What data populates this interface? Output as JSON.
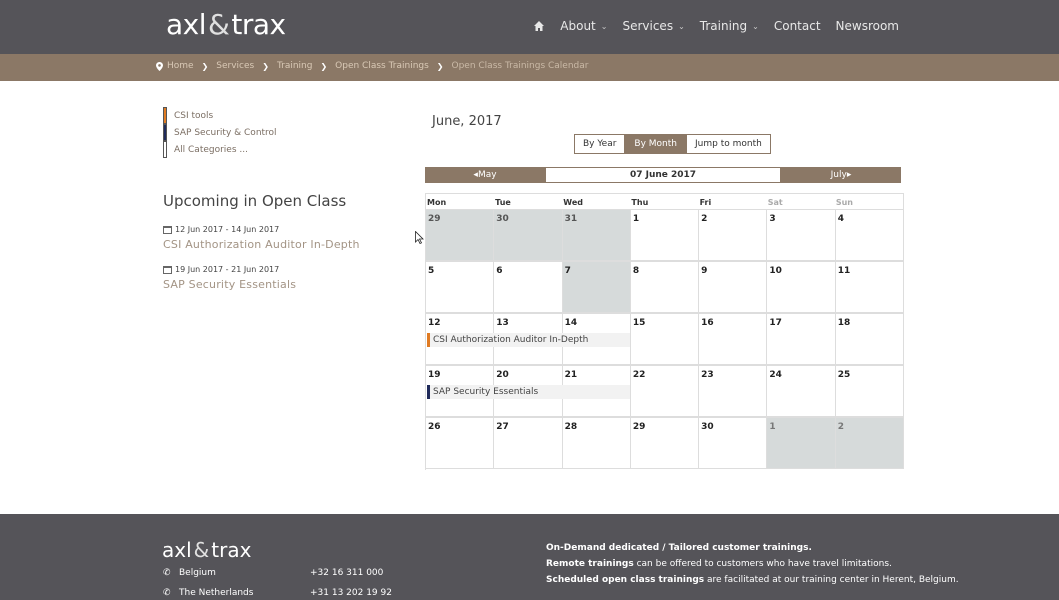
{
  "header": {
    "logo": {
      "part1": "axl",
      "amp": "&",
      "part2": "trax"
    },
    "nav": [
      {
        "label": "About",
        "caret": true
      },
      {
        "label": "Services",
        "caret": true
      },
      {
        "label": "Training",
        "caret": true
      },
      {
        "label": "Contact",
        "caret": false
      },
      {
        "label": "Newsroom",
        "caret": false
      }
    ]
  },
  "breadcrumb": [
    "Home",
    "Services",
    "Training",
    "Open Class Trainings",
    "Open Class Trainings Calendar"
  ],
  "sidebar": {
    "categories": [
      {
        "label": "CSI tools",
        "color": "#e07b22"
      },
      {
        "label": "SAP Security & Control",
        "color": "#1f2a5a"
      },
      {
        "label": "All Categories ...",
        "color": "#ffffff"
      }
    ],
    "upcoming_title": "Upcoming in Open Class",
    "events": [
      {
        "dates": "12 Jun 2017 - 14 Jun 2017",
        "title": "CSI Authorization Auditor In-Depth"
      },
      {
        "dates": "19 Jun 2017 - 21 Jun 2017",
        "title": "SAP Security Essentials"
      }
    ]
  },
  "calendar": {
    "month_title": "June, 2017",
    "views": {
      "by_year": "By Year",
      "by_month": "By Month",
      "jump": "Jump to month"
    },
    "prev_month": "May",
    "current_date": "07 June 2017",
    "next_month": "July",
    "weekdays": [
      "Mon",
      "Tue",
      "Wed",
      "Thu",
      "Fri",
      "Sat",
      "Sun"
    ],
    "weeks": [
      [
        "29",
        "30",
        "31",
        "1",
        "2",
        "3",
        "4"
      ],
      [
        "5",
        "6",
        "7",
        "8",
        "9",
        "10",
        "11"
      ],
      [
        "12",
        "13",
        "14",
        "15",
        "16",
        "17",
        "18"
      ],
      [
        "19",
        "20",
        "21",
        "22",
        "23",
        "24",
        "25"
      ],
      [
        "26",
        "27",
        "28",
        "29",
        "30",
        "1",
        "2"
      ]
    ],
    "events": [
      {
        "title": "CSI Authorization Auditor In-Depth",
        "color": "#e07b22"
      },
      {
        "title": "SAP Security Essentials",
        "color": "#1f2a5a"
      }
    ]
  },
  "footer": {
    "logo": {
      "part1": "axl",
      "amp": "&",
      "part2": "trax"
    },
    "contacts": [
      {
        "country": "Belgium",
        "phone": "+32 16 311 000"
      },
      {
        "country": "The Netherlands",
        "phone": "+31 13 202 19 92"
      }
    ],
    "lines": [
      {
        "bold": "On-Demand dedicated / Tailored customer trainings.",
        "rest": ""
      },
      {
        "bold": "Remote trainings",
        "rest": " can be offered to customers who have travel limitations."
      },
      {
        "bold": "Scheduled open class trainings",
        "rest": " are facilitated at our training center in Herent, Belgium."
      }
    ]
  },
  "colors": {
    "header_bg": "#555459",
    "accent": "#8b7866",
    "csi": "#e07b22",
    "sap": "#1f2a5a"
  }
}
